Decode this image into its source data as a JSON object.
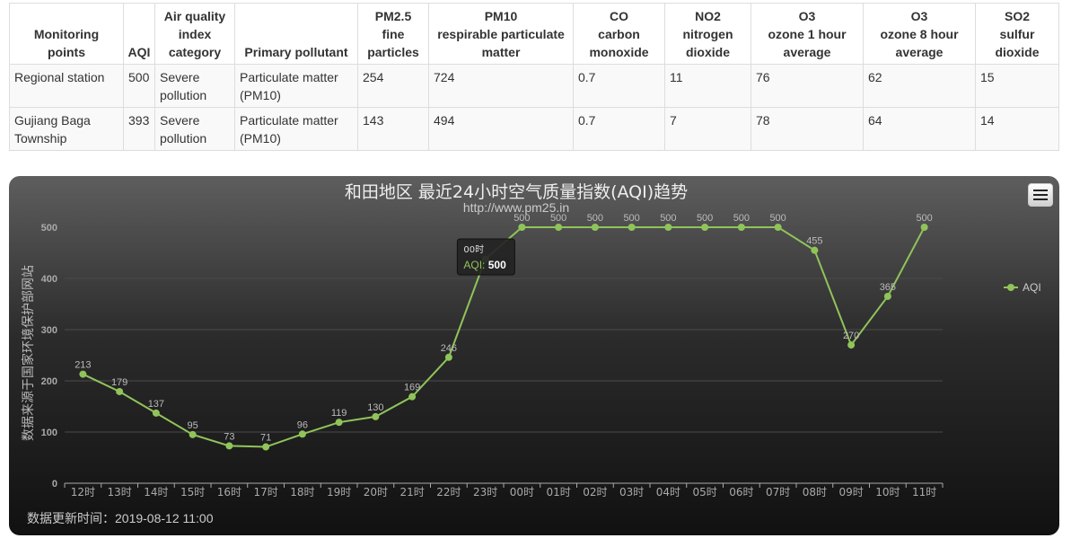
{
  "table": {
    "headers": [
      "Monitoring\npoints",
      "AQI",
      "Air quality\nindex\ncategory",
      "Primary pollutant",
      "PM2.5\nfine\nparticles",
      "PM10\nrespirable particulate\nmatter",
      "CO\ncarbon\nmonoxide",
      "NO2\nnitrogen\ndioxide",
      "O3\nozone 1 hour\naverage",
      "O3\nozone 8 hour\naverage",
      "SO2\nsulfur\ndioxide"
    ],
    "rows": [
      [
        "Regional station",
        "500",
        "Severe pollution",
        "Particulate matter (PM10)",
        "254",
        "724",
        "0.7",
        "11",
        "76",
        "62",
        "15"
      ],
      [
        "Gujiang Baga Township",
        "393",
        "Severe pollution",
        "Particulate matter (PM10)",
        "143",
        "494",
        "0.7",
        "7",
        "78",
        "64",
        "14"
      ]
    ]
  },
  "chart_data": {
    "type": "line",
    "title": "和田地区 最近24小时空气质量指数(AQI)趋势",
    "subtitle": "http://www.pm25.in",
    "ylabel": "数据来源于国家环境保护部网站",
    "xlabel": "",
    "categories": [
      "12时",
      "13时",
      "14时",
      "15时",
      "16时",
      "17时",
      "18时",
      "19时",
      "20时",
      "21时",
      "22时",
      "23时",
      "00时",
      "01时",
      "02时",
      "03时",
      "04时",
      "05时",
      "06时",
      "07时",
      "08时",
      "09时",
      "10时",
      "11时"
    ],
    "series": [
      {
        "name": "AQI",
        "values": [
          213,
          179,
          137,
          95,
          73,
          71,
          96,
          119,
          130,
          169,
          246,
          438,
          500,
          500,
          500,
          500,
          500,
          500,
          500,
          500,
          455,
          270,
          365,
          500
        ]
      }
    ],
    "ylim": [
      0,
      500
    ],
    "yticks": [
      0,
      100,
      200,
      300,
      400,
      500
    ],
    "grid": true,
    "legend_position": "right",
    "colors": {
      "series": "#90c45a",
      "background_top": "#5e5e5e",
      "background_bottom": "#111111"
    },
    "tooltip": {
      "category": "00时",
      "series": "AQI",
      "value": "500"
    },
    "hidden_label_indices": [
      11
    ]
  },
  "footer": {
    "update_time": "数据更新时间：2019-08-12 11:00"
  },
  "icons": {
    "menu": "hamburger-menu-icon"
  }
}
